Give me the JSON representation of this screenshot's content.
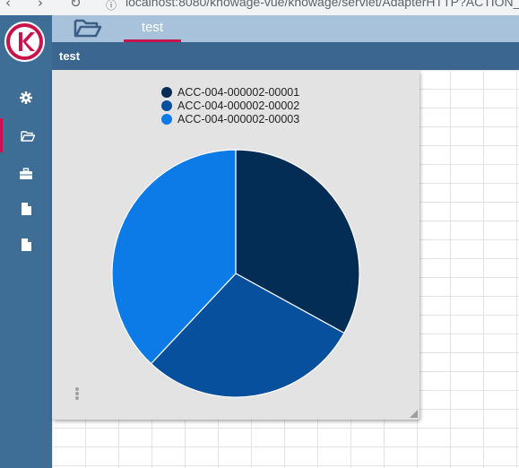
{
  "browser": {
    "back_glyph": "‹",
    "forward_glyph": "›",
    "reload_glyph": "↻",
    "url": "localhost:8080/knowage-vue/knowage/servlet/AdapterHTTP?ACTION_NAME=..."
  },
  "sidebar": {
    "logo_letter": "K",
    "items": [
      {
        "icon": "gear-icon"
      },
      {
        "icon": "folder-open-icon",
        "active": true
      },
      {
        "icon": "briefcase-icon"
      },
      {
        "icon": "file-icon"
      },
      {
        "icon": "file-icon"
      }
    ]
  },
  "topbar": {
    "folder_icon": "folder-open-icon",
    "tab_label": "test"
  },
  "titlebar": {
    "title": "test"
  },
  "colors": {
    "accent": "#c8144c",
    "sidebar": "#3e6d96",
    "topbar": "#a9c2dc",
    "titlebar": "#3b6690",
    "widget_bg": "#e3e3e3"
  },
  "chart_data": {
    "type": "pie",
    "title": "",
    "legend_position": "top",
    "categories": [
      "ACC-004-000002-00001",
      "ACC-004-000002-00002",
      "ACC-004-000002-00003"
    ],
    "values": [
      33,
      29,
      38
    ],
    "colors": [
      "#042d56",
      "#07509e",
      "#0c7be8"
    ]
  }
}
